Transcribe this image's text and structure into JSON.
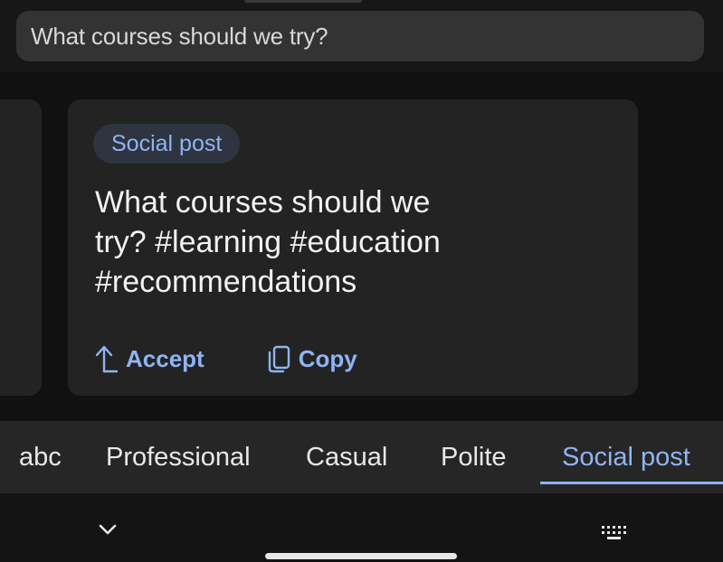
{
  "input": {
    "value": "What courses should we try?"
  },
  "suggestion_card": {
    "chip_label": "Social post",
    "text_lines": [
      "What courses should we",
      "try? #learning #education",
      "#recommendations"
    ],
    "accept_label": "Accept",
    "copy_label": "Copy"
  },
  "tabs": [
    {
      "label": "abc",
      "active": false
    },
    {
      "label": "Professional",
      "active": false
    },
    {
      "label": "Casual",
      "active": false
    },
    {
      "label": "Polite",
      "active": false
    },
    {
      "label": "Social post",
      "active": true
    }
  ],
  "icons": {
    "accept": "arrow-up-icon",
    "copy": "copy-icon",
    "collapse": "chevron-down-icon",
    "keyboard": "keyboard-icon"
  },
  "colors": {
    "accent": "#8fb4f4",
    "card_background": "#232323",
    "tab_bar_background": "#262626"
  }
}
